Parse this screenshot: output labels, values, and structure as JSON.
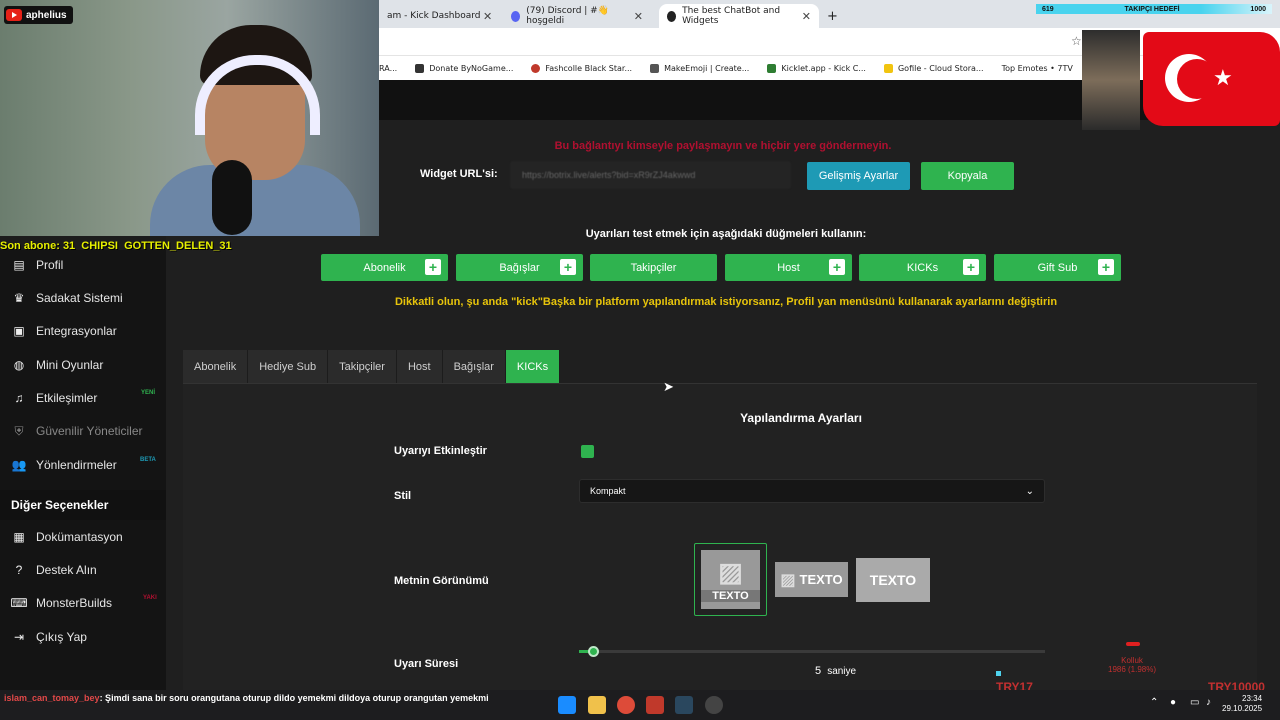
{
  "browser": {
    "tabs": [
      {
        "label": "am - Kick Dashboard",
        "active": false
      },
      {
        "label": "(79) Discord | #👋hoşgeldi",
        "active": false
      },
      {
        "label": "The best ChatBot and Widgets",
        "active": true
      }
    ],
    "new_tab": "+",
    "bookmarks": [
      "RA...",
      "Donate ByNoGame...",
      "Fashcolle Black Star...",
      "MakeEmoji | Create...",
      "Kicklet.app - Kick C...",
      "Gofile - Cloud Stora...",
      "Top Emotes • 7TV"
    ]
  },
  "overlay": {
    "channel": "aphelius",
    "last_sub": "Son abone: 31_CHIPSI_GOTTEN_DELEN_31",
    "goal_current": "619",
    "goal_label": "TAKIPÇI HEDEFİ",
    "goal_target": "1000",
    "donation_min": "TRY17",
    "donation_goal": "TRY10000",
    "donation_small_label": "Kolluk",
    "donation_small_value": "1986 (1.98%)"
  },
  "sidebar": {
    "items": [
      {
        "label": "Profil",
        "icon": "id-card-icon"
      },
      {
        "label": "Sadakat Sistemi",
        "icon": "trophy-icon"
      },
      {
        "label": "Entegrasyonlar",
        "icon": "window-icon"
      },
      {
        "label": "Mini Oyunlar",
        "icon": "gamepad-icon"
      },
      {
        "label": "Etkileşimler",
        "icon": "music-icon",
        "badge": "YENİ"
      },
      {
        "label": "Güvenilir Yöneticiler",
        "icon": "shield-icon",
        "dim": true
      },
      {
        "label": "Yönlendirmeler",
        "icon": "users-icon",
        "badge": "BETA"
      }
    ],
    "section_title": "Diğer Seçenekler",
    "other_items": [
      {
        "label": "Dokümantasyon",
        "icon": "document-icon"
      },
      {
        "label": "Destek Alın",
        "icon": "question-icon"
      },
      {
        "label": "MonsterBuilds",
        "icon": "laptop-icon",
        "badge": "YAKI"
      },
      {
        "label": "Çıkış Yap",
        "icon": "logout-icon"
      }
    ]
  },
  "main": {
    "warning": "Bu bağlantıyı kimseyle paylaşmayın ve hiçbir yere göndermeyin.",
    "widget_url_label": "Widget URL'si:",
    "widget_url_value": "https://botrix.live/alerts?bid=xR9rZJ4akwwd",
    "advanced_button": "Gelişmiş Ayarlar",
    "copy_button": "Kopyala",
    "test_label": "Uyarıları test etmek için aşağıdaki düğmeleri kullanın:",
    "test_buttons": [
      "Abonelik",
      "Bağışlar",
      "Takipçiler",
      "Host",
      "KICKs",
      "Gift Sub"
    ],
    "platform_warning": "Dikkatli olun, şu anda \"kick\"Başka bir platform yapılandırmak istiyorsanız, Profil yan menüsünü kullanarak ayarlarını değiştirin",
    "tabs": [
      "Abonelik",
      "Hediye Sub",
      "Takipçiler",
      "Host",
      "Bağışlar",
      "KICKs"
    ],
    "active_tab": "KICKs",
    "config_title": "Yapılandırma Ayarları",
    "enable_label": "Uyarıyı Etkinleştir",
    "enabled": true,
    "style_label": "Stil",
    "style_value": "Kompakt",
    "text_view_label": "Metnin Görünümü",
    "text_option": "TEXTO",
    "duration_label": "Uyarı Süresi",
    "duration_value": "5",
    "duration_unit": "saniye"
  },
  "chat": {
    "user": "islam_can_tomay_bey",
    "message": ": Şimdi sana bir soru orangutana oturup dildo yemekmi dildoya oturup orangutan yemekmi"
  },
  "clock": {
    "time": "23:34",
    "date": "29.10.2025"
  },
  "colors": {
    "accent": "#2fb34f",
    "info": "#1e9ab5",
    "warning": "#e7c40b",
    "danger": "#b01030"
  }
}
